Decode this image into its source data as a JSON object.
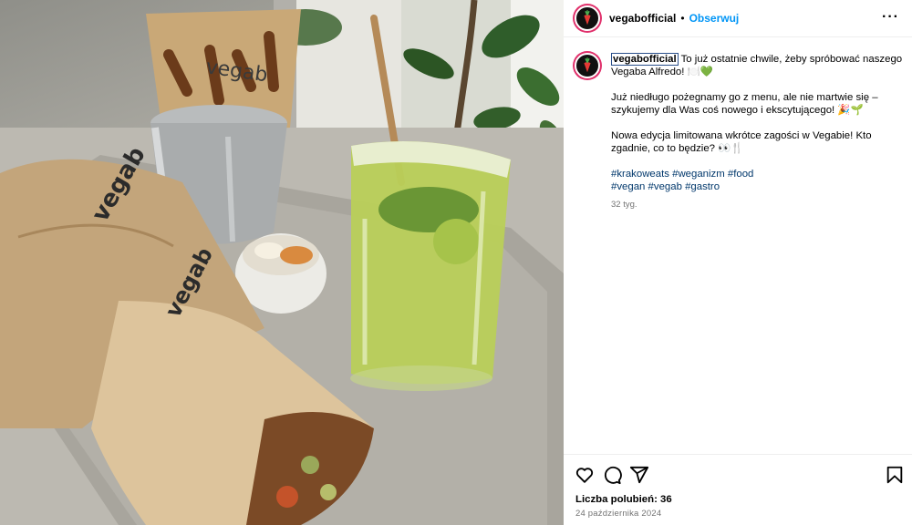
{
  "post": {
    "username": "vegabofficial",
    "dot": "•",
    "follow_label": "Obserwuj",
    "more_label": "···",
    "caption": {
      "line1": "To już ostatnie chwile, żeby spróbować naszego Vegaba Alfredo! 🍽️💚",
      "line2": "Już niedługo pożegnamy go z menu, ale nie martwie się – szykujemy dla Was coś nowego i ekscytującego! 🎉🌱",
      "line3": "Nowa edycja limitowana wkrótce zagości w Vegabie! Kto zgadnie, co to będzie? 👀🍴",
      "hashtags_line1": "#krakoweats #weganizm #food",
      "hashtags_line2": "#vegan #vegab #gastro"
    },
    "time_ago": "32 tyg.",
    "likes_label": "Liczba polubień: 36",
    "date": "24 października 2024"
  },
  "photo": {
    "wrap_brand": "vegab",
    "basket_brand": "vegab"
  },
  "icons": [
    "carrot-icon",
    "more-icon",
    "heart-icon",
    "comment-icon",
    "share-icon",
    "bookmark-icon"
  ],
  "colors": {
    "follow": "#0095f6",
    "hashtag": "#00376b",
    "muted": "#737373",
    "avatar_ring": "#e0306b"
  }
}
